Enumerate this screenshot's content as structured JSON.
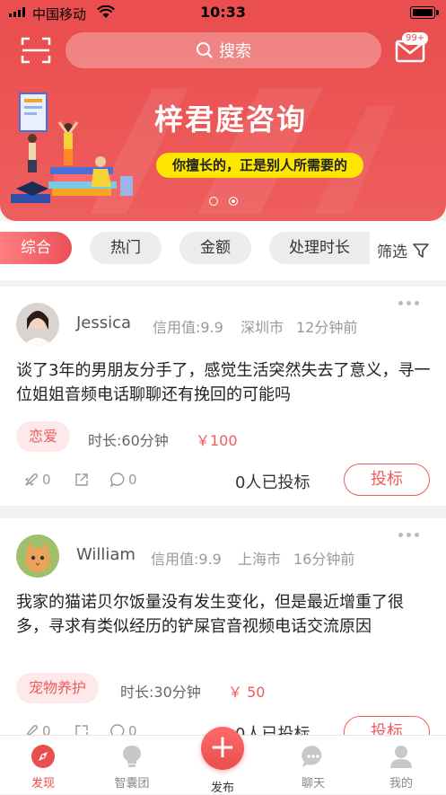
{
  "status_bar": {
    "carrier": "中国移动",
    "time": "10:33"
  },
  "header": {
    "search_placeholder": "搜索",
    "message_badge": "99+"
  },
  "banner": {
    "title": "梓君庭咨询",
    "subtitle": "你擅长的，正是别人所需要的",
    "slide_count": 2,
    "active_slide": 2
  },
  "filters": {
    "chips": [
      "综合",
      "热门",
      "金额",
      "处理时长"
    ],
    "active": "综合",
    "filter_label": "筛选"
  },
  "posts": [
    {
      "user": "Jessica",
      "credit": "信用值:9.9",
      "city": "深圳市",
      "time_ago": "12分钟前",
      "content": "谈了3年的男朋友分手了，感觉生活突然失去了意义，寻一位姐姐音频电话聊聊还有挽回的可能吗",
      "tag": "恋爱",
      "duration": "时长:60分钟",
      "price": "￥100",
      "likes": "0",
      "comments": "0",
      "bids": "0人已投标",
      "bid_button": "投标"
    },
    {
      "user": "William",
      "credit": "信用值:9.9",
      "city": "上海市",
      "time_ago": "16分钟前",
      "content": "我家的猫诺贝尔饭量没有发生变化，但是最近增重了很多，寻求有类似经历的铲屎官音视频电话交流原因",
      "tag": "宠物养护",
      "duration": "时长:30分钟",
      "price": "￥ 50",
      "likes": "0",
      "comments": "0",
      "bids": "0人已投标",
      "bid_button": "投标"
    }
  ],
  "tabbar": {
    "tabs": [
      "发现",
      "智囊团",
      "发布",
      "聊天",
      "我的"
    ],
    "active": "发现",
    "publish_symbol": "+"
  },
  "colors": {
    "brand": "#ea4e4f",
    "accent_yellow": "#ffe600",
    "tag_bg": "#fde9e9"
  },
  "icons": [
    "scan-icon",
    "search-icon",
    "message-icon",
    "filter-icon",
    "rocket-icon",
    "share-icon",
    "comment-icon",
    "compass-icon",
    "bulb-icon",
    "chat-icon",
    "person-icon"
  ]
}
